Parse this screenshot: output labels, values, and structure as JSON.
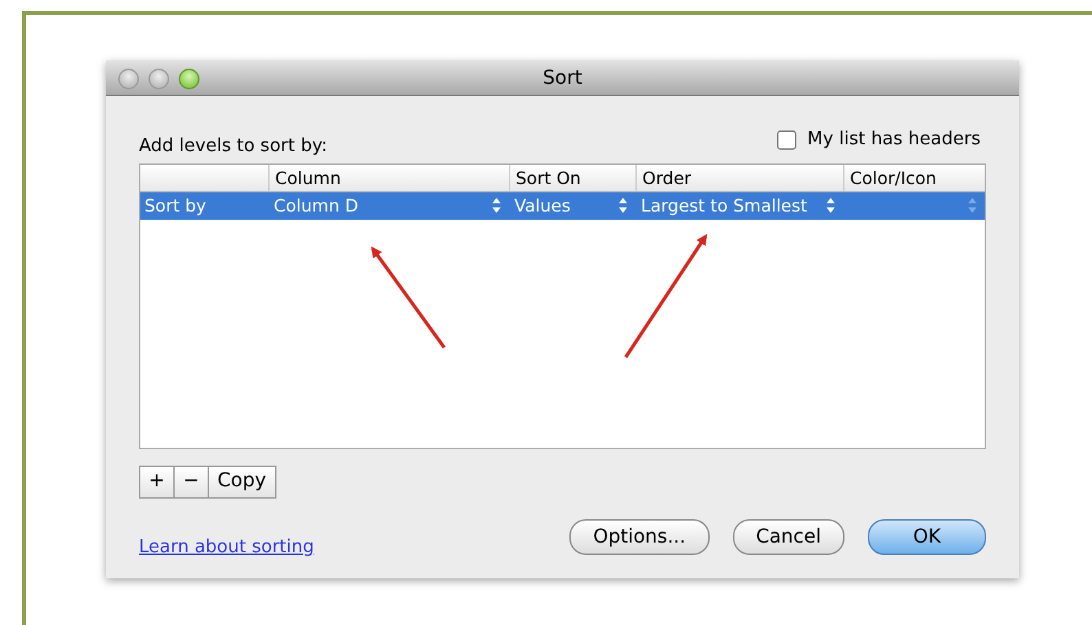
{
  "window": {
    "title": "Sort"
  },
  "heading": "Add levels to sort by:",
  "headers_checkbox": {
    "label": "My list has headers",
    "checked": false
  },
  "table": {
    "columns": [
      "Column",
      "Sort On",
      "Order",
      "Color/Icon"
    ],
    "rows": [
      {
        "label": "Sort by",
        "selected": true,
        "cells": [
          {
            "value": "Column D"
          },
          {
            "value": "Values"
          },
          {
            "value": "Largest to Smallest"
          },
          {
            "disabled": true
          }
        ]
      }
    ]
  },
  "level_buttons": [
    "+",
    "−",
    "Copy"
  ],
  "link": "Learn about sorting",
  "buttons": [
    {
      "label": "Options...",
      "default": false
    },
    {
      "label": "Cancel",
      "default": false
    },
    {
      "label": "OK",
      "default": true
    }
  ]
}
